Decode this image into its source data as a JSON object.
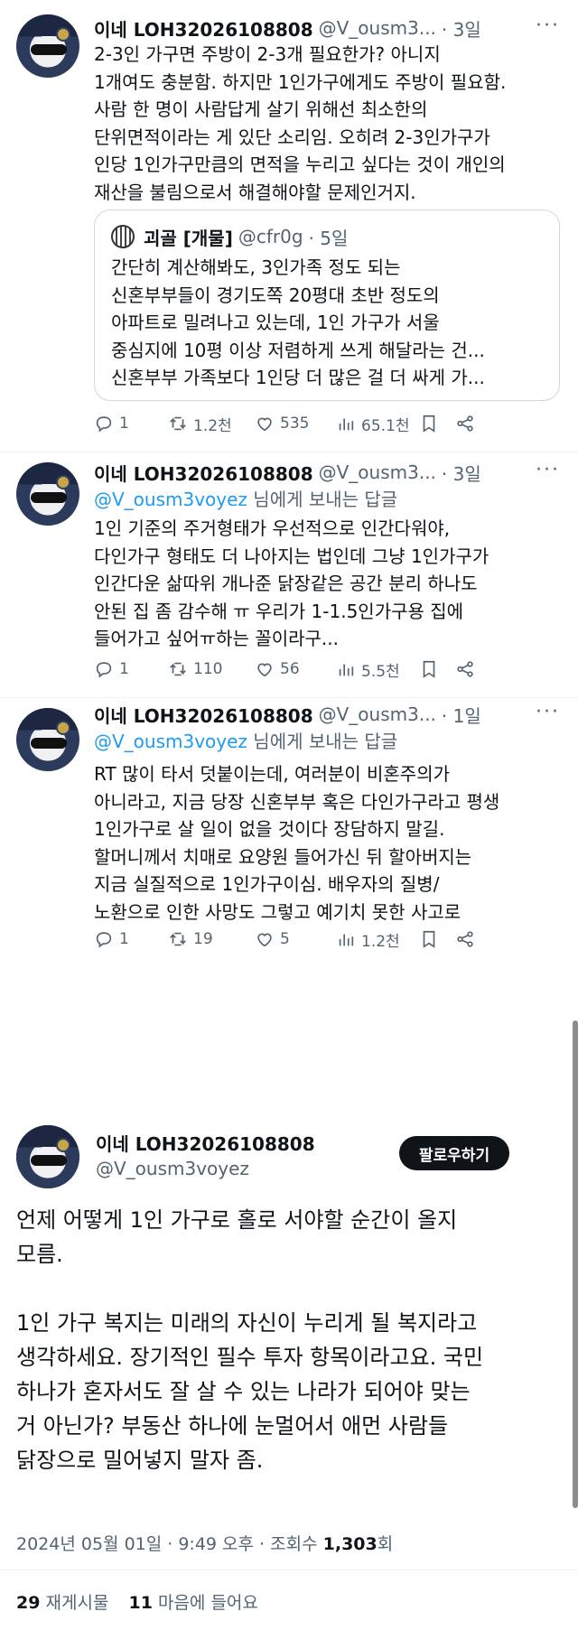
{
  "tweets": [
    {
      "name": "이네 LOH32026108808",
      "handle": "@V_ousm3...",
      "time": "· 3일",
      "lines": [
        "2-3인 가구면 주방이 2-3개 필요한가? 아니지",
        "1개여도 충분함. 하지만 1인가구에게도 주방이 필요함.",
        "사람 한 명이 사람답게 살기 위해선 최소한의",
        "단위면적이라는 게 있단 소리임. 오히려 2-3인가구가",
        "인당 1인가구만큼의 면적을 누리고 싶다는 것이 개인의",
        "재산을 불림으로서 해결해야할 문제인거지."
      ],
      "quote": {
        "name": "괴골 [개물]",
        "handle": "@cfr0g",
        "time": "· 5일",
        "lines": [
          "간단히 계산해봐도, 3인가족 정도 되는",
          "신혼부부들이 경기도쪽 20평대 초반 정도의",
          "아파트로 밀려나고 있는데, 1인 가구가 서울",
          "중심지에 10평 이상 저렴하게 쓰게 해달라는 건...",
          "신혼부부 가족보다 1인당 더 많은 걸 더 싸게 가..."
        ]
      },
      "replies": "1",
      "retweets": "1.2천",
      "likes": "535",
      "views": "65.1천"
    },
    {
      "name": "이네 LOH32026108808",
      "handle": "@V_ousm3...",
      "time": "· 3일",
      "reply_to": "@V_ousm3voyez",
      "reply_suffix": " 님에게 보내는 답글",
      "lines": [
        "1인 기준의 주거형태가 우선적으로 인간다워야,",
        "다인가구 형태도 더 나아지는 법인데 그냥 1인가구가",
        "인간다운 삶따위 개나준 닭장같은 공간 분리 하나도",
        "안된 집 좀 감수해 ㅠ 우리가 1-1.5인가구용 집에",
        "들어가고 싶어ㅠ하는 꼴이라구..."
      ],
      "replies": "1",
      "retweets": "110",
      "likes": "56",
      "views": "5.5천"
    },
    {
      "name": "이네 LOH32026108808",
      "handle": "@V_ousm3...",
      "time": "· 1일",
      "reply_to": "@V_ousm3voyez",
      "reply_suffix": " 님에게 보내는 답글",
      "lines": [
        "RT 많이 타서 덧붙이는데, 여러분이 비혼주의가",
        "아니라고, 지금 당장 신혼부부 혹은 다인가구라고 평생",
        "1인가구로 살 일이 없을 것이다 장담하지 말길.",
        "할머니께서 치매로 요양원 들어가신 뒤 할아버지는",
        "지금 실질적으로 1인가구이심. 배우자의 질병/",
        "노환으로 인한 사망도 그렇고 예기치 못한 사고로"
      ],
      "replies": "1",
      "retweets": "19",
      "likes": "5",
      "views": "1.2천"
    }
  ],
  "main": {
    "name": "이네 LOH32026108808",
    "handle": "@V_ousm3voyez",
    "follow_label": "팔로우하기",
    "lines": [
      "언제 어떻게 1인 가구로 홀로 서야할 순간이 올지",
      "모름.",
      "",
      "1인 가구 복지는 미래의 자신이 누리게 될 복지라고",
      "생각하세요. 장기적인 필수 투자 항목이라고요. 국민",
      "하나가 혼자서도 잘 살 수 있는 나라가 되어야 맞는",
      "거 아닌가? 부동산 하나에 눈멀어서 애먼 사람들",
      "닭장으로 밀어넣지 말자 좀."
    ],
    "date": "2024년 05월 01일 · 9:49 오후 · 조회수 ",
    "view_count": "1,303",
    "view_suffix": "회",
    "retweet_count": "29",
    "retweet_label": " 재게시물",
    "like_count": "11",
    "like_label": " 마음에 들어요"
  },
  "icons": [
    "reply-icon",
    "retweet-icon",
    "like-icon",
    "views-icon",
    "bookmark-icon",
    "share-icon"
  ],
  "colors": {
    "link": "#1d9bf0",
    "secondary": "#536471",
    "text": "#0f1419"
  }
}
